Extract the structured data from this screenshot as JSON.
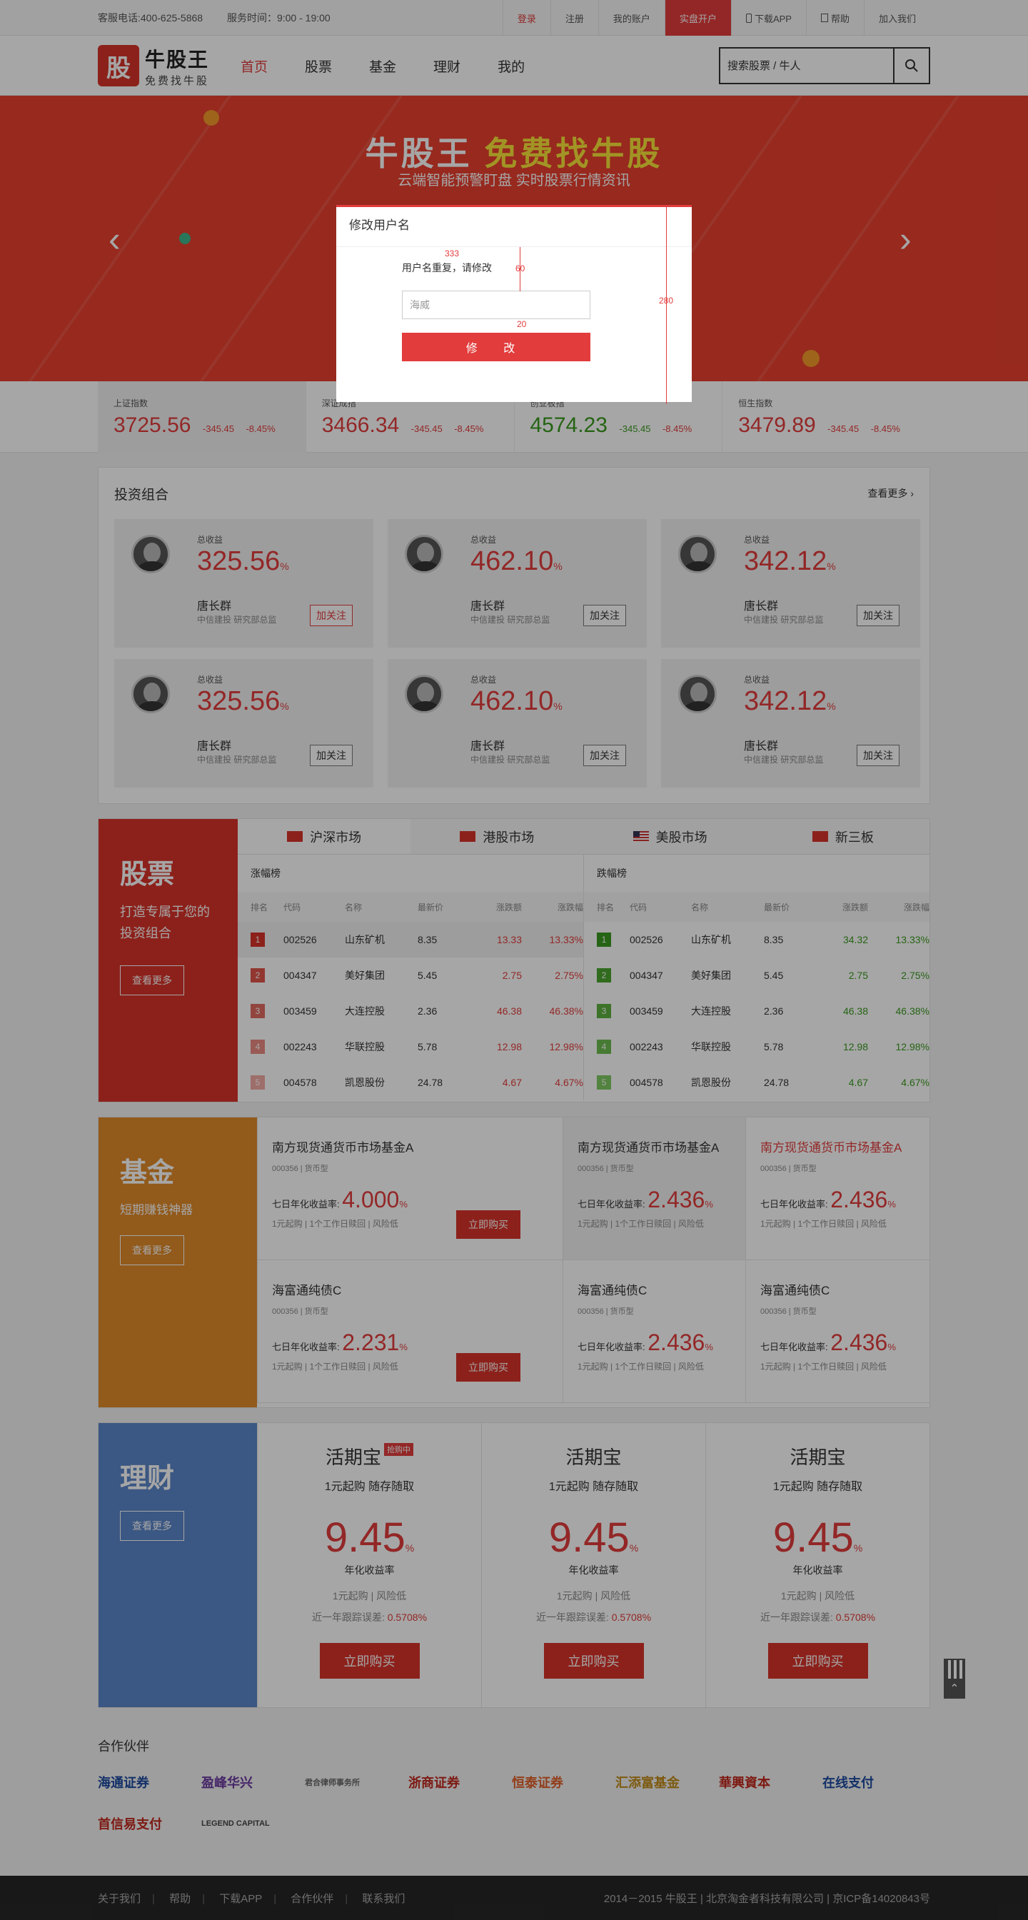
{
  "topbar": {
    "phone": "客服电话:400-625-5868",
    "hours": "服务时间：9:00 - 19:00",
    "login": "登录",
    "register": "注册",
    "account": "我的账户",
    "open": "实盘开户",
    "download": "下载APP",
    "help": "帮助",
    "join": "加入我们"
  },
  "header": {
    "logo_char": "股",
    "logo_title": "牛股王",
    "logo_sub": "免费找牛股",
    "nav": [
      "首页",
      "股票",
      "基金",
      "理财",
      "我的"
    ],
    "search_placeholder": "搜索股票 / 牛人"
  },
  "banner": {
    "title_white": "牛股王",
    "title_yellow": "免费找牛股",
    "subtitle": "云端智能预警盯盘 实时股票行情资讯"
  },
  "indices": [
    {
      "name": "上证指数",
      "value": "3725.56",
      "chg": "-345.45",
      "pct": "-8.45%",
      "dir": "up"
    },
    {
      "name": "深证成指",
      "value": "3466.34",
      "chg": "-345.45",
      "pct": "-8.45%",
      "dir": "up"
    },
    {
      "name": "创业板指",
      "value": "4574.23",
      "chg": "-345.45",
      "pct": "-8.45%",
      "dir": "down"
    },
    {
      "name": "恒生指数",
      "value": "3479.89",
      "chg": "-345.45",
      "pct": "-8.45%",
      "dir": "up"
    }
  ],
  "portfolio": {
    "title": "投资组合",
    "more": "查看更多",
    "cards": [
      {
        "label": "总收益",
        "pct": "325.56",
        "unit": "%",
        "name": "唐长群",
        "org": "中信建投 研究部总监",
        "btn": "加关注",
        "btn_red": true
      },
      {
        "label": "总收益",
        "pct": "462.10",
        "unit": "%",
        "name": "唐长群",
        "org": "中信建投 研究部总监",
        "btn": "加关注",
        "btn_red": false
      },
      {
        "label": "总收益",
        "pct": "342.12",
        "unit": "%",
        "name": "唐长群",
        "org": "中信建投 研究部总监",
        "btn": "加关注",
        "btn_red": false
      },
      {
        "label": "总收益",
        "pct": "325.56",
        "unit": "%",
        "name": "唐长群",
        "org": "中信建投 研究部总监",
        "btn": "加关注",
        "btn_red": false
      },
      {
        "label": "总收益",
        "pct": "462.10",
        "unit": "%",
        "name": "唐长群",
        "org": "中信建投 研究部总监",
        "btn": "加关注",
        "btn_red": false
      },
      {
        "label": "总收益",
        "pct": "342.12",
        "unit": "%",
        "name": "唐长群",
        "org": "中信建投 研究部总监",
        "btn": "加关注",
        "btn_red": false
      }
    ]
  },
  "stock": {
    "side_title": "股票",
    "side_desc1": "打造专属于您的",
    "side_desc2": "投资组合",
    "side_more": "查看更多",
    "tabs": [
      "沪深市场",
      "港股市场",
      "美股市场",
      "新三板"
    ],
    "gain_title": "涨幅榜",
    "loss_title": "跌幅榜",
    "headers": [
      "排名",
      "代码",
      "名称",
      "最新价",
      "涨跌额",
      "涨跌幅"
    ],
    "gain_rows": [
      [
        "1",
        "002526",
        "山东矿机",
        "8.35",
        "13.33",
        "13.33%"
      ],
      [
        "2",
        "004347",
        "美好集团",
        "5.45",
        "2.75",
        "2.75%"
      ],
      [
        "3",
        "003459",
        "大连控股",
        "2.36",
        "46.38",
        "46.38%"
      ],
      [
        "4",
        "002243",
        "华联控股",
        "5.78",
        "12.98",
        "12.98%"
      ],
      [
        "5",
        "004578",
        "凯恩股份",
        "24.78",
        "4.67",
        "4.67%"
      ]
    ],
    "loss_rows": [
      [
        "1",
        "002526",
        "山东矿机",
        "8.35",
        "34.32",
        "13.33%"
      ],
      [
        "2",
        "004347",
        "美好集团",
        "5.45",
        "2.75",
        "2.75%"
      ],
      [
        "3",
        "003459",
        "大连控股",
        "2.36",
        "46.38",
        "46.38%"
      ],
      [
        "4",
        "002243",
        "华联控股",
        "5.78",
        "12.98",
        "12.98%"
      ],
      [
        "5",
        "004578",
        "凯恩股份",
        "24.78",
        "4.67",
        "4.67%"
      ]
    ]
  },
  "fund": {
    "side_title": "基金",
    "side_desc": "短期赚钱神器",
    "side_more": "查看更多",
    "cells": [
      {
        "name": "南方现货通货币市场基金A",
        "type": "000356  |  货币型",
        "rate_label": "七日年化收益率:",
        "rate": "4.000",
        "unit": "%",
        "foot": "1元起购  |  1个工作日赎回  |  风险低",
        "buy": "立即购买"
      },
      {
        "name": "南方现货通货币市场基金A",
        "type": "000356  |  货币型",
        "rate_label": "七日年化收益率:",
        "rate": "2.436",
        "unit": "%",
        "foot": "1元起购  |  1个工作日赎回  |  风险低"
      },
      {
        "name": "南方现货通货币市场基金A",
        "type": "000356  |  货币型",
        "rate_label": "七日年化收益率:",
        "rate": "2.436",
        "unit": "%",
        "foot": "1元起购  |  1个工作日赎回  |  风险低"
      },
      {
        "name": "海富通纯债C",
        "type": "000356  |  货币型",
        "rate_label": "七日年化收益率:",
        "rate": "2.231",
        "unit": "%",
        "foot": "1元起购  |  1个工作日赎回  |  风险低",
        "buy": "立即购买"
      },
      {
        "name": "海富通纯债C",
        "type": "000356  |  货币型",
        "rate_label": "七日年化收益率:",
        "rate": "2.436",
        "unit": "%",
        "foot": "1元起购  |  1个工作日赎回  |  风险低"
      },
      {
        "name": "海富通纯债C",
        "type": "000356  |  货币型",
        "rate_label": "七日年化收益率:",
        "rate": "2.436",
        "unit": "%",
        "foot": "1元起购  |  1个工作日赎回  |  风险低"
      }
    ]
  },
  "finance": {
    "side_title": "理财",
    "side_more": "查看更多",
    "cells": [
      {
        "name": "活期宝",
        "tag": "抢购中",
        "sub": "1元起购  随存随取",
        "rate": "9.45",
        "unit": "%",
        "rate_label": "年化收益率",
        "info": "1元起购  |  风险低",
        "err_label": "近一年跟踪误差:",
        "err": "0.5708%",
        "buy": "立即购买"
      },
      {
        "name": "活期宝",
        "tag": "",
        "sub": "1元起购  随存随取",
        "rate": "9.45",
        "unit": "%",
        "rate_label": "年化收益率",
        "info": "1元起购  |  风险低",
        "err_label": "近一年跟踪误差:",
        "err": "0.5708%",
        "buy": "立即购买"
      },
      {
        "name": "活期宝",
        "tag": "",
        "sub": "1元起购  随存随取",
        "rate": "9.45",
        "unit": "%",
        "rate_label": "年化收益率",
        "info": "1元起购  |  风险低",
        "err_label": "近一年跟踪误差:",
        "err": "0.5708%",
        "buy": "立即购买"
      }
    ]
  },
  "partners": {
    "title": "合作伙伴",
    "logos": [
      "海通证券",
      "盈峰华兴",
      "君合律师事务所",
      "浙商证券",
      "恒泰证券",
      "汇添富基金",
      "華興資本",
      "在线支付",
      "首信易支付",
      "LEGEND CAPITAL"
    ]
  },
  "footer": {
    "links": [
      "关于我们",
      "帮助",
      "下载APP",
      "合作伙伴",
      "联系我们"
    ],
    "copyright": "2014－2015 牛股王  |  北京淘金者科技有限公司  |  京ICP备14020843号"
  },
  "modal": {
    "title": "修改用户名",
    "message": "用户名重复，请修改",
    "input_placeholder": "海威",
    "button": "修 改",
    "annotations": [
      "333",
      "60",
      "20",
      "280"
    ]
  },
  "colors": {
    "accent": "#e23c3c",
    "stock_side": "#d8342a",
    "fund_side": "#e08a2a",
    "finance_side": "#5b86c9",
    "gain": "#e23c3c",
    "loss": "#3a9a1f"
  }
}
